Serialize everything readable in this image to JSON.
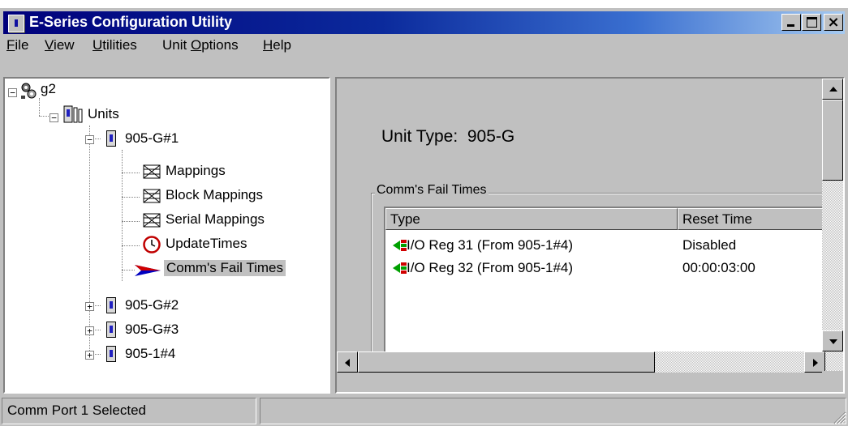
{
  "window": {
    "title": "E-Series Configuration Utility",
    "title_bar_color": "#00007b"
  },
  "menu": [
    {
      "label": "File",
      "key": "F",
      "rest": "ile"
    },
    {
      "label": "View",
      "key": "V",
      "rest": "iew"
    },
    {
      "label": "Utilities",
      "key": "U",
      "rest": "tilities"
    },
    {
      "label": "Unit Options",
      "pre": "Unit ",
      "key": "O",
      "rest": "ptions"
    },
    {
      "label": "Help",
      "key": "H",
      "rest": "elp"
    }
  ],
  "tree": {
    "root": {
      "label": "g2",
      "icon": "network-gear-icon"
    },
    "units_folder": {
      "label": "Units",
      "icon": "units-rack-icon"
    },
    "unit1": {
      "label": "905-G#1",
      "icon": "unit-device-icon"
    },
    "children": [
      {
        "label": "Mappings",
        "icon": "mapping-grid-icon"
      },
      {
        "label": "Block Mappings",
        "icon": "mapping-grid-icon"
      },
      {
        "label": "Serial Mappings",
        "icon": "mapping-grid-icon"
      },
      {
        "label": "UpdateTimes",
        "icon": "clock-icon"
      },
      {
        "label": "Comm's Fail Times",
        "icon": "red-blue-arrow-icon",
        "selected": true
      }
    ],
    "other_units": [
      {
        "label": "905-G#2"
      },
      {
        "label": "905-G#3"
      },
      {
        "label": "905-1#4"
      }
    ]
  },
  "detail": {
    "unit_type_label": "Unit Type:",
    "unit_type_value": "905-G",
    "group_title": "Comm's Fail Times",
    "columns": [
      "Type",
      "Reset Time"
    ],
    "rows": [
      {
        "type": "I/O Reg 31  (From 905-1#4)",
        "reset_time": "Disabled",
        "icon": "io-register-icon"
      },
      {
        "type": "I/O Reg 32  (From 905-1#4)",
        "reset_time": "00:00:03:00",
        "icon": "io-register-icon"
      }
    ]
  },
  "status": {
    "message": "Comm Port 1 Selected",
    "second_panel": ""
  }
}
